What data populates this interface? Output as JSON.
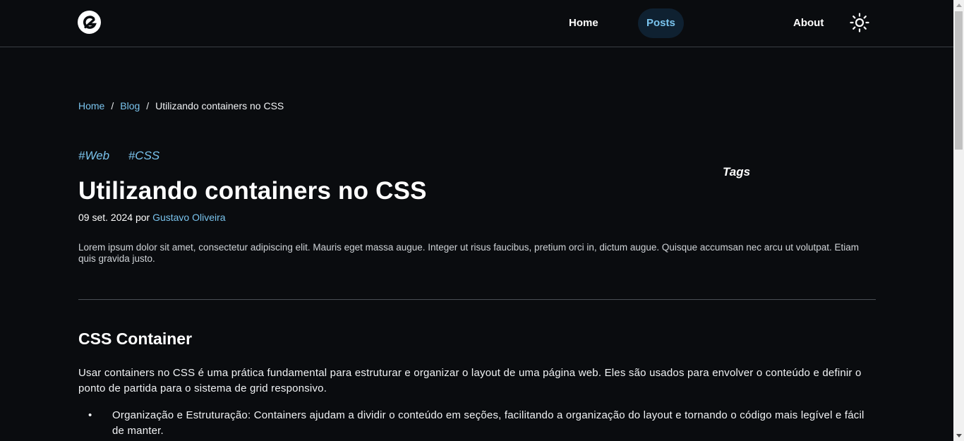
{
  "nav": {
    "home": "Home",
    "posts": "Posts",
    "tags": "Tags",
    "about": "About"
  },
  "breadcrumb": {
    "home": "Home",
    "blog": "Blog",
    "current": "Utilizando containers no CSS",
    "separator": "/"
  },
  "post": {
    "tags": [
      "#Web",
      "#CSS"
    ],
    "title": "Utilizando containers no CSS",
    "date": "09 set. 2024",
    "by": "por",
    "author": "Gustavo Oliveira",
    "excerpt": "Lorem ipsum dolor sit amet, consectetur adipiscing elit. Mauris eget massa augue. Integer ut risus faucibus, pretium orci in, dictum augue. Quisque accumsan nec arcu ut volutpat. Etiam quis gravida justo."
  },
  "content": {
    "heading": "CSS Container",
    "paragraph": "Usar containers no CSS é uma prática fundamental para estruturar e organizar o layout de uma página web. Eles são usados para envolver o conteúdo e definir o ponto de partida para o sistema de grid responsivo.",
    "bullets": [
      "Organização e Estruturação: Containers ajudam a dividir o conteúdo em seções, facilitando a organização do layout e tornando o código mais legível e fácil de manter."
    ]
  },
  "colors": {
    "background": "#0a0c0f",
    "accent": "#7ac4ee",
    "active_nav_bg": "#0f2131"
  },
  "icons": {
    "logo": "logo-icon",
    "theme": "sun-icon",
    "bullet": "•"
  }
}
